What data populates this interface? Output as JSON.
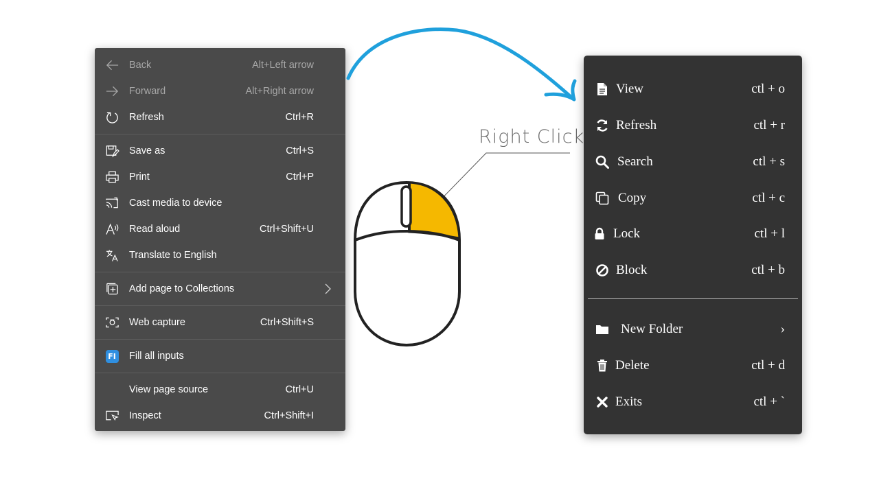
{
  "edge_menu": {
    "groups": [
      [
        {
          "label": "Back",
          "shortcut": "Alt+Left arrow",
          "icon": "back-arrow-icon",
          "disabled": true
        },
        {
          "label": "Forward",
          "shortcut": "Alt+Right arrow",
          "icon": "forward-arrow-icon",
          "disabled": true
        },
        {
          "label": "Refresh",
          "shortcut": "Ctrl+R",
          "icon": "refresh-icon",
          "disabled": false
        }
      ],
      [
        {
          "label": "Save as",
          "shortcut": "Ctrl+S",
          "icon": "save-as-icon",
          "disabled": false
        },
        {
          "label": "Print",
          "shortcut": "Ctrl+P",
          "icon": "printer-icon",
          "disabled": false
        },
        {
          "label": "Cast media to device",
          "shortcut": "",
          "icon": "cast-icon",
          "disabled": false
        },
        {
          "label": "Read aloud",
          "shortcut": "Ctrl+Shift+U",
          "icon": "read-aloud-icon",
          "disabled": false
        },
        {
          "label": "Translate to English",
          "shortcut": "",
          "icon": "translate-icon",
          "disabled": false
        }
      ],
      [
        {
          "label": "Add page to Collections",
          "shortcut": "",
          "icon": "collections-icon",
          "submenu": true,
          "disabled": false
        }
      ],
      [
        {
          "label": "Web capture",
          "shortcut": "Ctrl+Shift+S",
          "icon": "web-capture-icon",
          "disabled": false
        }
      ],
      [
        {
          "label": "Fill all inputs",
          "shortcut": "",
          "icon": "fill-inputs-extension-icon",
          "badge": "FI",
          "disabled": false
        }
      ],
      [
        {
          "label": "View page source",
          "shortcut": "Ctrl+U",
          "icon": "",
          "disabled": false
        },
        {
          "label": "Inspect",
          "shortcut": "Ctrl+Shift+I",
          "icon": "inspect-icon",
          "disabled": false
        }
      ]
    ]
  },
  "illustration": {
    "label": "Right Click",
    "arrow_color": "#1fa0dc",
    "highlight_color": "#f5b800"
  },
  "custom_menu": {
    "items": [
      {
        "label": "View",
        "shortcut": "ctl + o",
        "icon": "document-icon"
      },
      {
        "label": "Refresh",
        "shortcut": "ctl + r",
        "icon": "refresh-icon"
      },
      {
        "label": "Search",
        "shortcut": "ctl + s",
        "icon": "search-icon"
      },
      {
        "label": "Copy",
        "shortcut": "ctl + c",
        "icon": "copy-icon"
      },
      {
        "label": "Lock",
        "shortcut": "ctl + l",
        "icon": "lock-icon"
      },
      {
        "label": "Block",
        "shortcut": "ctl + b",
        "icon": "block-icon"
      },
      {
        "label": "New Folder",
        "shortcut": "›",
        "icon": "folder-icon"
      },
      {
        "label": "Delete",
        "shortcut": "ctl + d",
        "icon": "trash-icon"
      },
      {
        "label": "Exits",
        "shortcut": "ctl + `",
        "icon": "close-x-icon"
      }
    ]
  }
}
